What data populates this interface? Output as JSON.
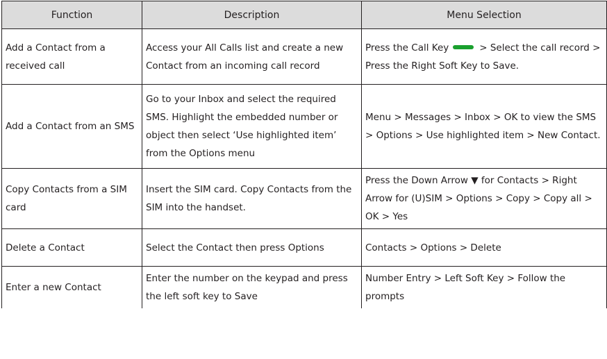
{
  "table": {
    "headers": [
      "Function",
      "Description",
      "Menu Selection"
    ],
    "rows": [
      {
        "function": "Add a Contact from a received call",
        "description": "Access your All Calls list and create a new Contact from an incoming call record",
        "menu_before_icon": "Press the Call Key",
        "menu_after_icon": "> Select the call record > Press the Right Soft Key to Save."
      },
      {
        "function": "Add a Contact from an SMS",
        "description": "Go to your Inbox and select the required SMS. Highlight the embedded number or object then select ‘Use highlighted item’ from the Options menu",
        "menu": "Menu > Messages > Inbox > OK to view the SMS > Options > Use highlighted item > New Contact."
      },
      {
        "function": "Copy Contacts from a SIM card",
        "description": "Insert the SIM card. Copy Contacts from the SIM into the handset.",
        "menu": "Press the Down Arrow ▼ for Contacts > Right Arrow for (U)SIM > Options > Copy > Copy all > OK > Yes"
      },
      {
        "function": "Delete a Contact",
        "description": "Select the Contact then press Options",
        "menu": "Contacts > Options > Delete"
      },
      {
        "function": "Enter a new Contact",
        "description": "Enter the number on the keypad and press the left soft key to Save",
        "menu": "Number Entry > Left Soft Key > Follow the prompts"
      }
    ],
    "call_key_icon": "green-call-key-icon",
    "call_key_color": "#1aa02e",
    "header_bg": "#dcdcdc"
  }
}
